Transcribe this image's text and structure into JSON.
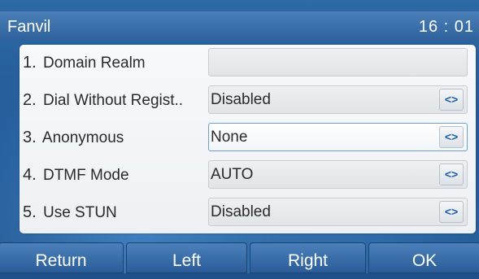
{
  "header": {
    "app_name": "Fanvil",
    "time": "16 : 01"
  },
  "settings": [
    {
      "number": "1.",
      "label": "Domain Realm",
      "value": "",
      "has_selector": false
    },
    {
      "number": "2.",
      "label": "Dial Without Regist..",
      "value": "Disabled",
      "has_selector": true
    },
    {
      "number": "3.",
      "label": "Anonymous",
      "value": "None",
      "has_selector": true
    },
    {
      "number": "4.",
      "label": "DTMF Mode",
      "value": "AUTO",
      "has_selector": true
    },
    {
      "number": "5.",
      "label": "Use STUN",
      "value": "Disabled",
      "has_selector": true
    }
  ],
  "selector_glyph": "<>",
  "selected_row": 3,
  "softkeys": {
    "return": "Return",
    "left": "Left",
    "right": "Right",
    "ok": "OK"
  },
  "colors": {
    "accent": "#1f5fa5",
    "selected_border": "#6a9ed4",
    "header": "#2f629c"
  }
}
